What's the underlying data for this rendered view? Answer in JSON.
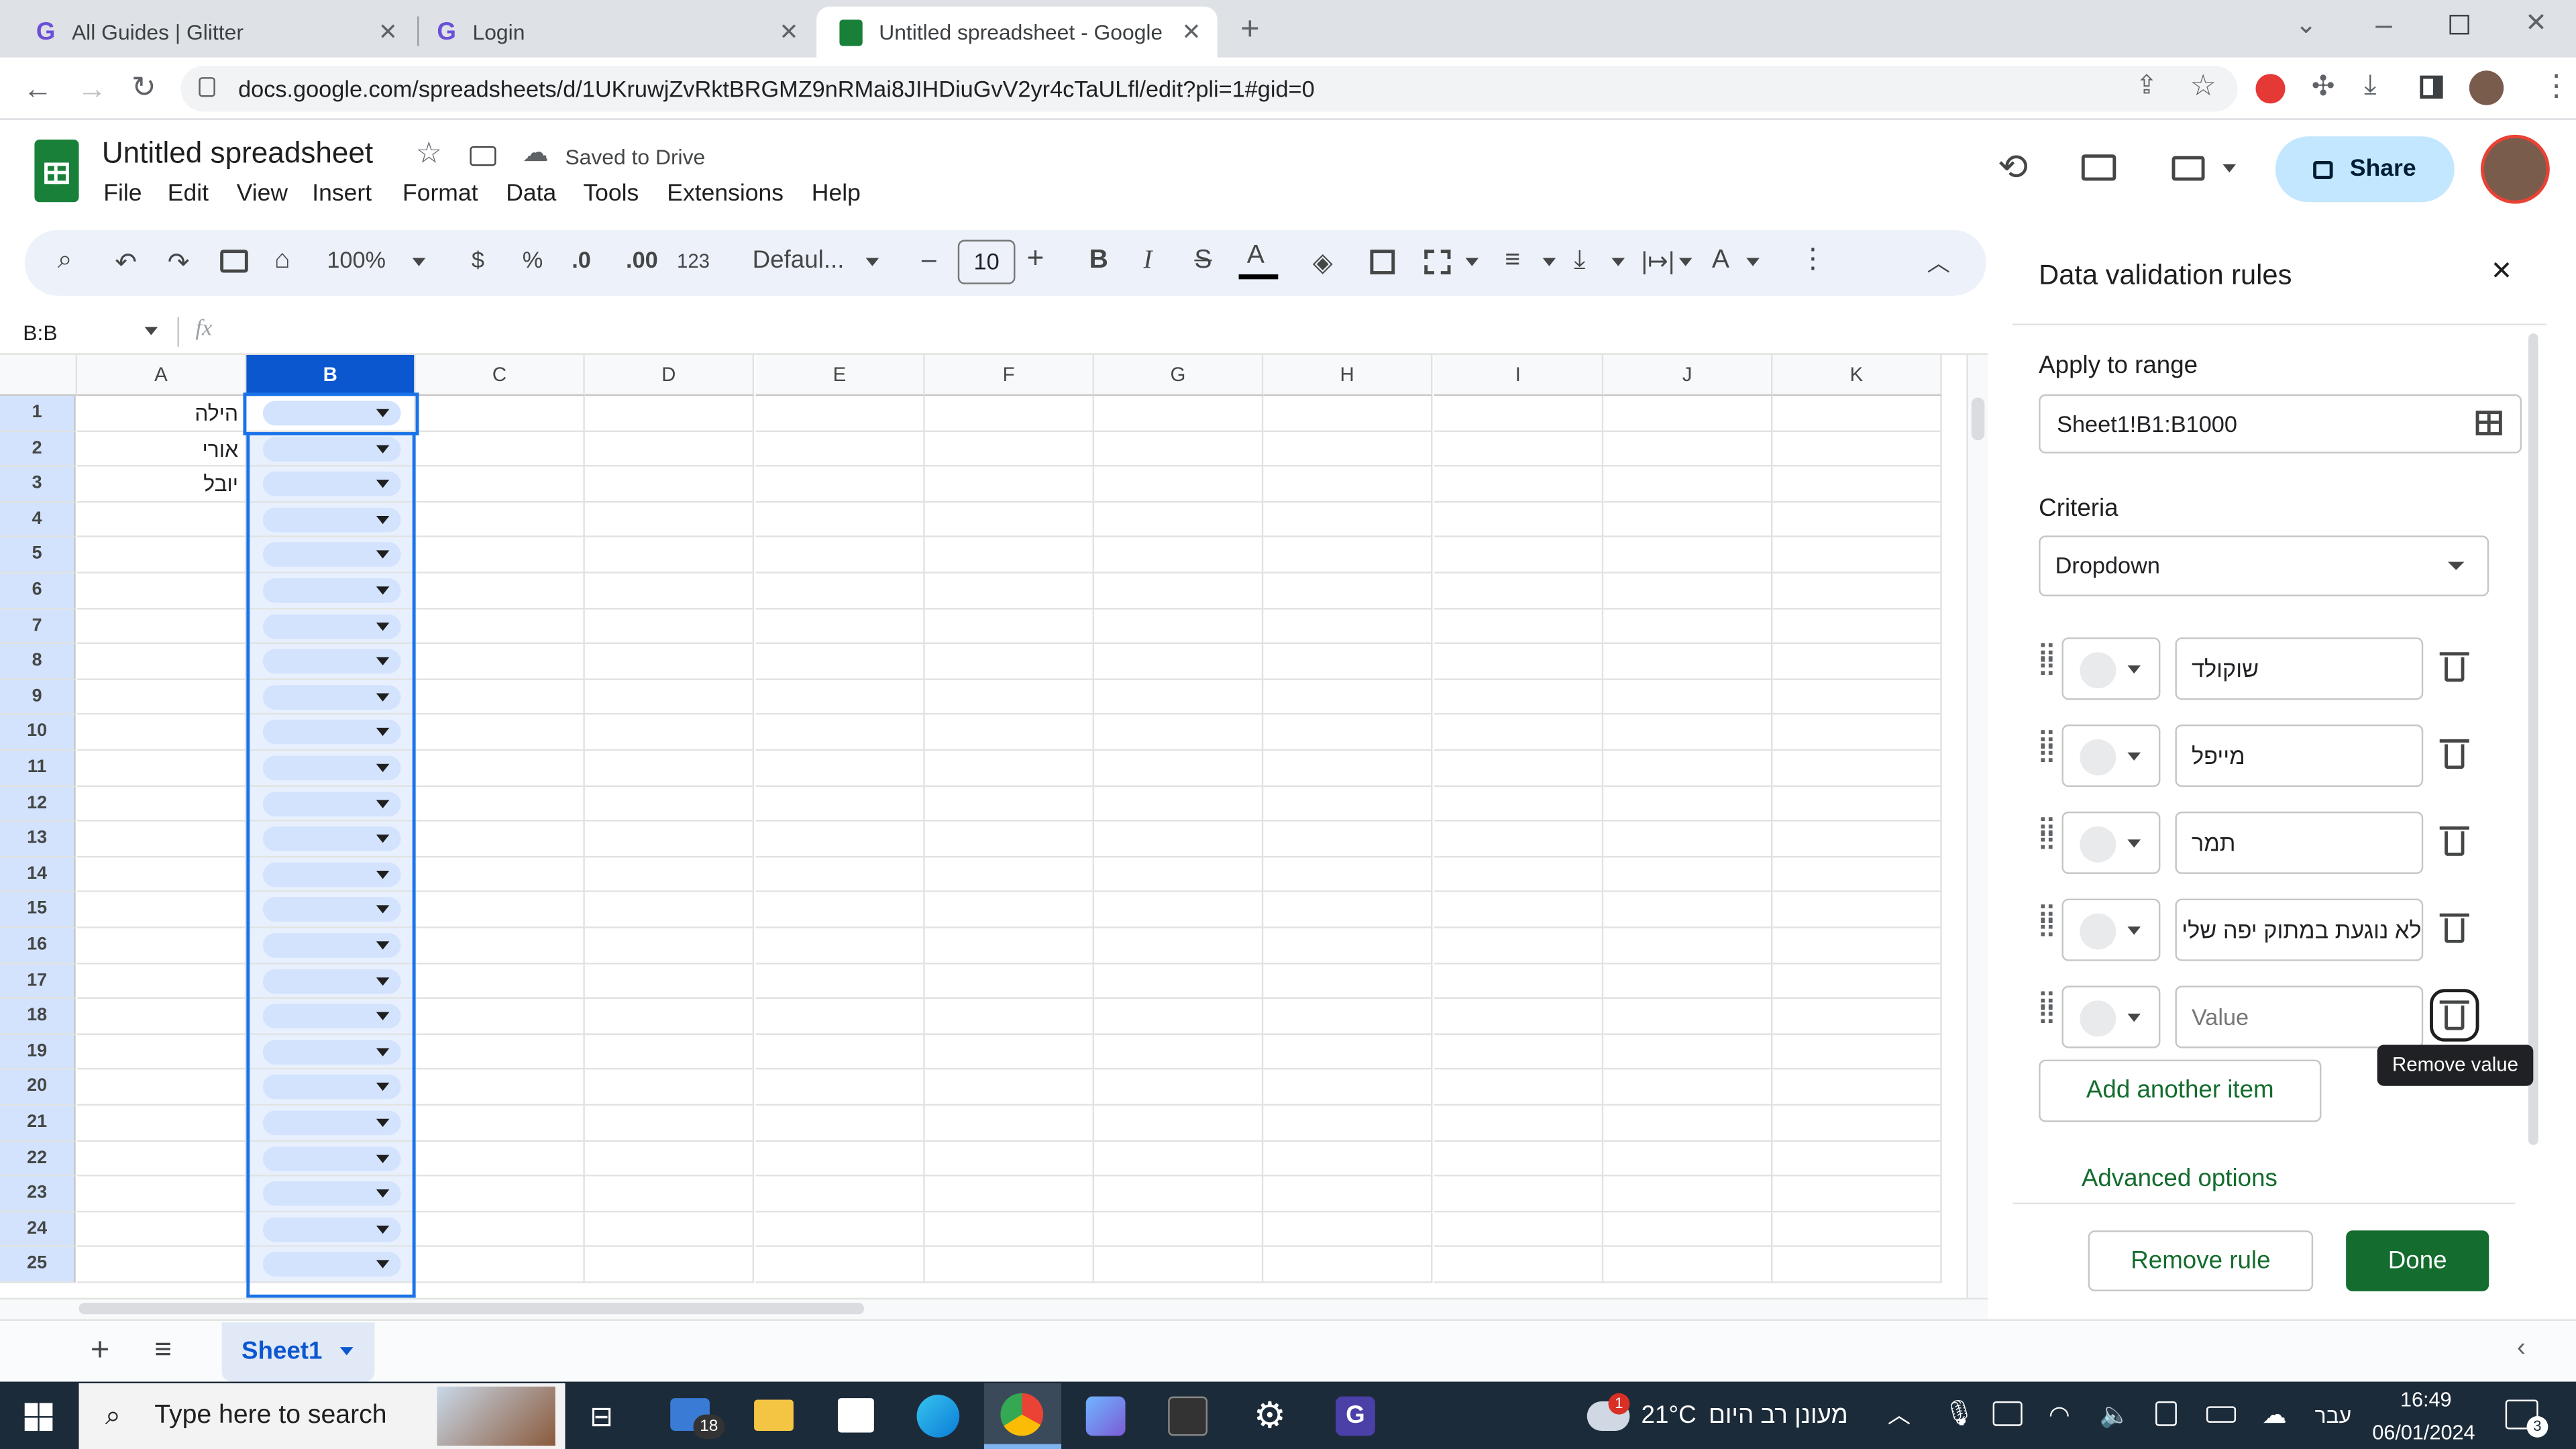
{
  "browser": {
    "tabs": [
      {
        "title": "All Guides | Glitter"
      },
      {
        "title": "Login"
      },
      {
        "title": "Untitled spreadsheet - Google Sheets"
      }
    ],
    "url": "docs.google.com/spreadsheets/d/1UKruwjZvRktBRGMZ9nRMai8JIHDiuGvV2yr4cTaULfl/edit?pli=1#gid=0"
  },
  "doc": {
    "title": "Untitled spreadsheet",
    "saved": "Saved to Drive",
    "menus": [
      "File",
      "Edit",
      "View",
      "Insert",
      "Format",
      "Data",
      "Tools",
      "Extensions",
      "Help"
    ],
    "share": "Share"
  },
  "toolbar": {
    "zoom": "100%",
    "currency": "$",
    "percent": "%",
    "dec_down": ".0",
    "dec_up": ".00",
    "format_123": "123",
    "font": "Defaul...",
    "font_size": "10",
    "minus": "–",
    "plus": "+"
  },
  "formula": {
    "name_box": "B:B",
    "fx": "fx"
  },
  "grid": {
    "columns": [
      "A",
      "B",
      "C",
      "D",
      "E",
      "F",
      "G",
      "H",
      "I",
      "J",
      "K"
    ],
    "rows": [
      "1",
      "2",
      "3",
      "4",
      "5",
      "6",
      "7",
      "8",
      "9",
      "10",
      "11",
      "12",
      "13",
      "14",
      "15",
      "16",
      "17",
      "18",
      "19",
      "20",
      "21",
      "22",
      "23",
      "24",
      "25"
    ],
    "col_a_values": [
      "הילה",
      "אורי",
      "יובל"
    ],
    "selected_column": "B"
  },
  "panel": {
    "title": "Data validation rules",
    "apply_label": "Apply to range",
    "range": "Sheet1!B1:B1000",
    "criteria_label": "Criteria",
    "criteria": "Dropdown",
    "items": [
      "שוקולד",
      "מייפל",
      "תמר",
      "לא נוגעת במתוק יפה שלי"
    ],
    "value_placeholder": "Value",
    "tooltip": "Remove value",
    "add_item": "Add another item",
    "advanced": "Advanced options",
    "remove_rule": "Remove rule",
    "done": "Done"
  },
  "sheets": {
    "active": "Sheet1"
  },
  "taskbar": {
    "search_placeholder": "Type here to search",
    "mail_badge": "18",
    "weather_temp": "21°C",
    "weather_text": "מעונן רב היום",
    "weather_badge": "1",
    "lang": "עבר",
    "time": "16:49",
    "date": "06/01/2024",
    "notif_count": "3"
  },
  "colors": {
    "accent_blue": "#0b57d0",
    "sheets_green": "#188038",
    "done_green": "#146c2e",
    "selection_blue": "#d3e3fd",
    "share_bg": "#c2e7ff"
  }
}
